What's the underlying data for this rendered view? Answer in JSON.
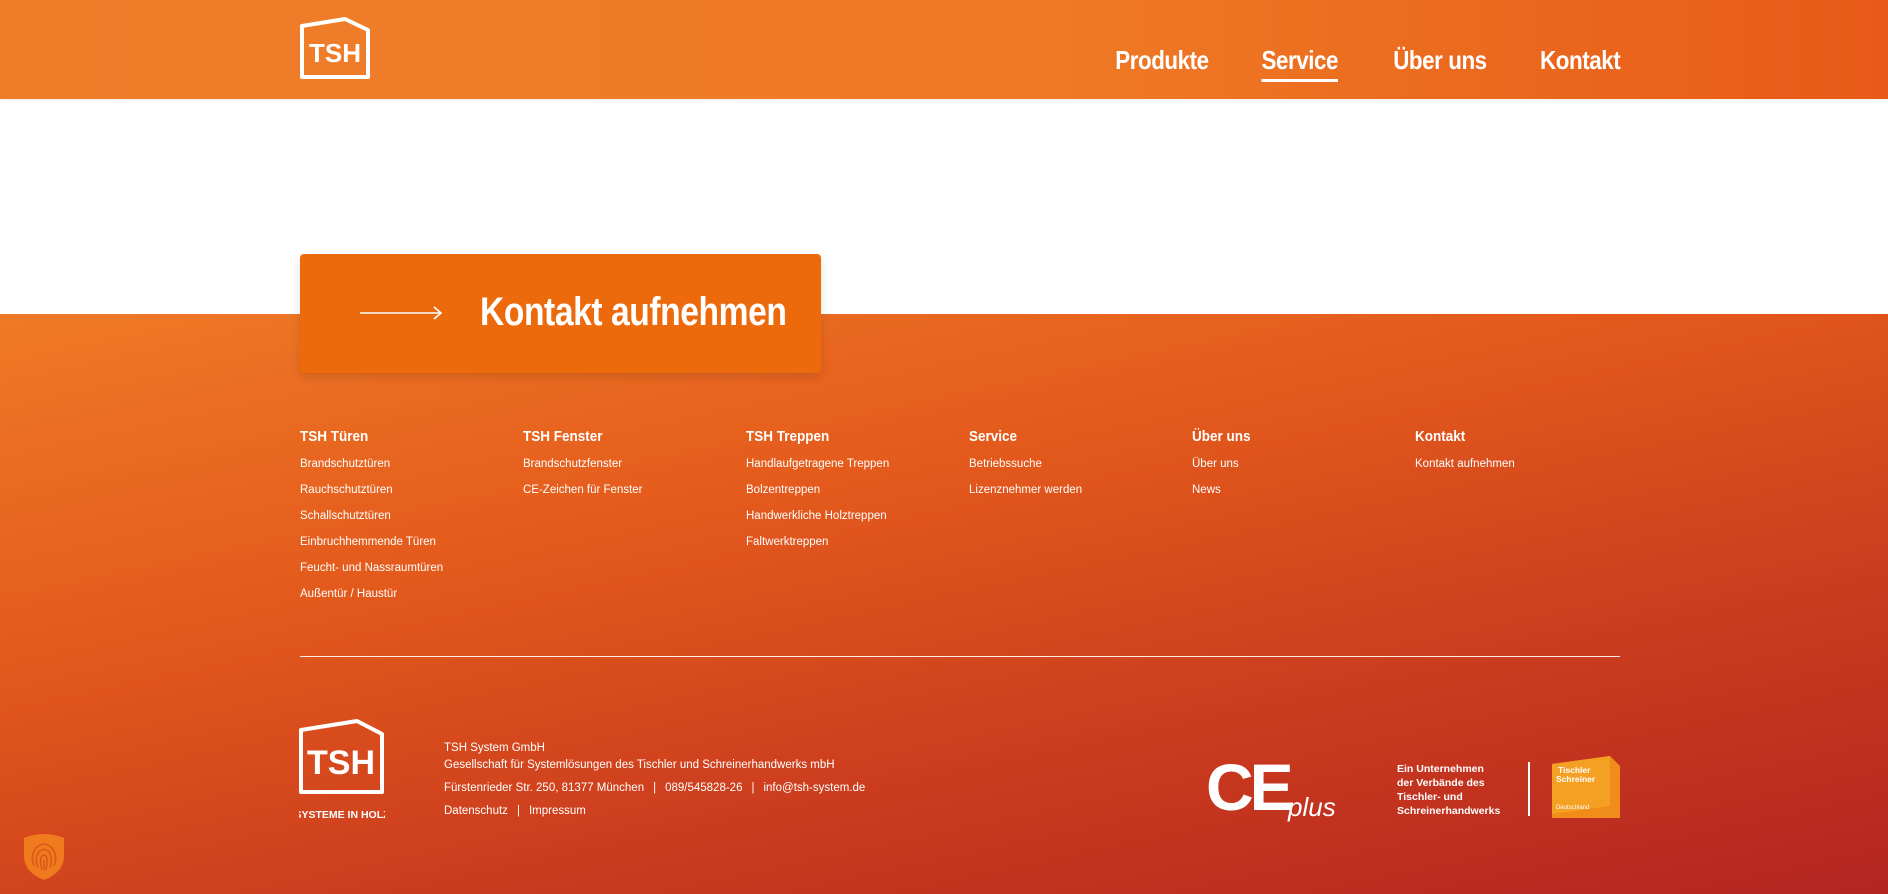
{
  "header": {
    "logo_text": "TSH",
    "nav": [
      {
        "label": "Produkte",
        "active": false
      },
      {
        "label": "Service",
        "active": true
      },
      {
        "label": "Über uns",
        "active": false
      },
      {
        "label": "Kontakt",
        "active": false
      }
    ]
  },
  "cta": {
    "label": "Kontakt aufnehmen",
    "icon": "arrow-right-icon"
  },
  "footer": {
    "columns": [
      {
        "title": "TSH Türen",
        "links": [
          "Brandschutztüren",
          "Rauchschutztüren",
          "Schallschutztüren",
          "Einbruchhemmende Türen",
          "Feucht- und Nassraumtüren",
          "Außentür / Haustür"
        ]
      },
      {
        "title": "TSH Fenster",
        "links": [
          "Brandschutzfenster",
          "CE-Zeichen für Fenster"
        ]
      },
      {
        "title": "TSH Treppen",
        "links": [
          "Handlaufgetragene Treppen",
          "Bolzentreppen",
          "Handwerkliche Holztreppen",
          "Faltwerktreppen"
        ]
      },
      {
        "title": "Service",
        "links": [
          "Betriebssuche",
          "Lizenznehmer werden"
        ]
      },
      {
        "title": "Über uns",
        "links": [
          "Über uns",
          "News"
        ]
      },
      {
        "title": "Kontakt",
        "links": [
          "Kontakt aufnehmen"
        ]
      }
    ],
    "logo_text": "TSH",
    "logo_tagline": "SYSTEME IN HOLZ",
    "company": "TSH System GmbH",
    "company_desc": "Gesellschaft für Systemlösungen des Tischler und Schreinerhandwerks mbH",
    "address": "Fürstenrieder Str. 250, 81377 München",
    "phone": "089/545828-26",
    "email": "info@tsh-system.de",
    "legal": [
      "Datenschutz",
      "Impressum"
    ],
    "ce_text": "CE",
    "ce_plus": "plus",
    "verband_lines": [
      "Ein Unternehmen",
      "der Verbände des",
      "Tischler- und",
      "Schreinerhandwerks"
    ],
    "badge_lines": [
      "Tischler",
      "Schreiner",
      "Deutschland"
    ]
  },
  "colors": {
    "accent": "#ed6a0c",
    "header": "#ef7a25",
    "footer_dark": "#b42421"
  }
}
